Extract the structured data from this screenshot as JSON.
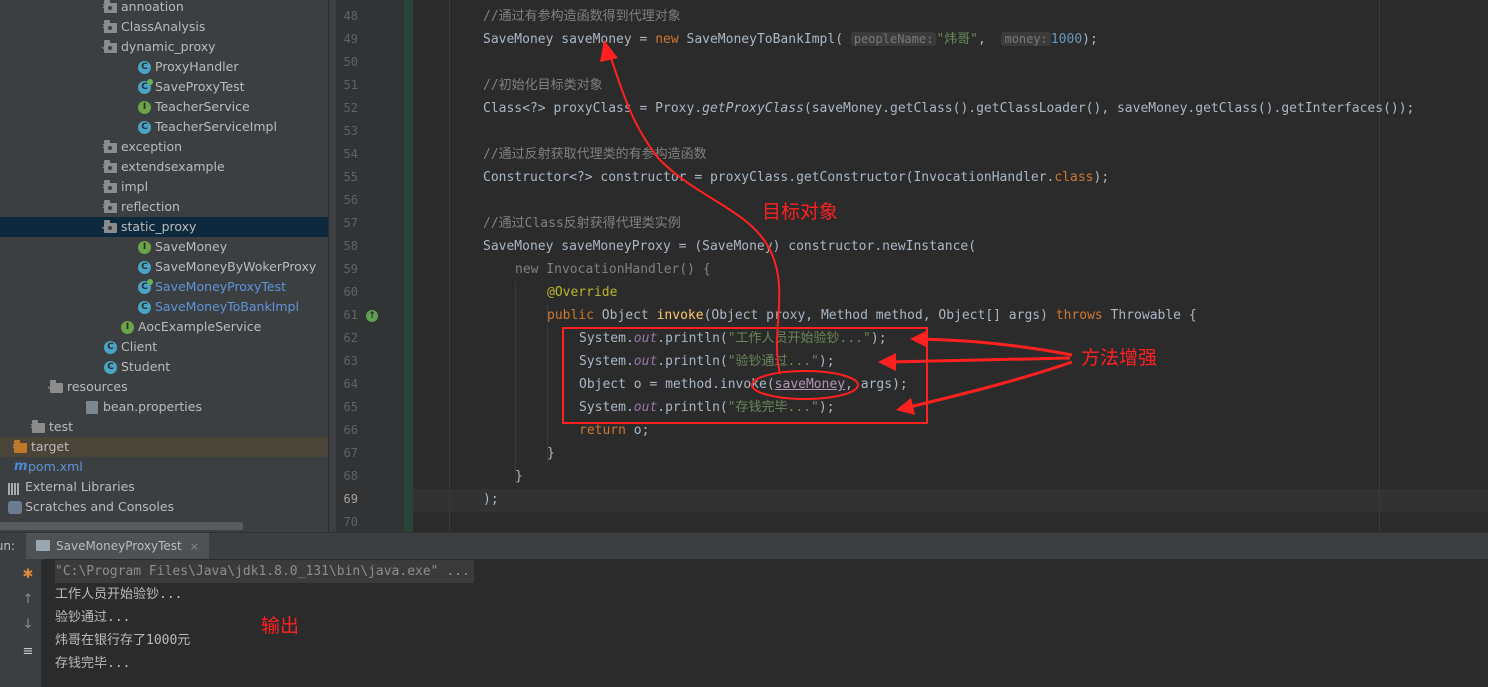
{
  "project_tree": {
    "items": [
      {
        "label": "annoation",
        "type": "package",
        "arrow": "›"
      },
      {
        "label": "ClassAnalysis",
        "type": "package",
        "arrow": "›"
      },
      {
        "label": "dynamic_proxy",
        "type": "package",
        "arrow": "⌄"
      },
      {
        "label": "ProxyHandler",
        "type": "class"
      },
      {
        "label": "SaveProxyTest",
        "type": "test-class"
      },
      {
        "label": "TeacherService",
        "type": "interface"
      },
      {
        "label": "TeacherServiceImpl",
        "type": "class"
      },
      {
        "label": "exception",
        "type": "package",
        "arrow": "›"
      },
      {
        "label": "extendsexample",
        "type": "package",
        "arrow": "›"
      },
      {
        "label": "impl",
        "type": "package",
        "arrow": "›"
      },
      {
        "label": "reflection",
        "type": "package",
        "arrow": "›"
      },
      {
        "label": "static_proxy",
        "type": "package",
        "arrow": "⌄"
      },
      {
        "label": "SaveMoney",
        "type": "interface"
      },
      {
        "label": "SaveMoneyByWokerProxy",
        "type": "class"
      },
      {
        "label": "SaveMoneyProxyTest",
        "type": "test-class"
      },
      {
        "label": "SaveMoneyToBankImpl",
        "type": "class"
      },
      {
        "label": "AocExampleService",
        "type": "interface"
      },
      {
        "label": "Client",
        "type": "class"
      },
      {
        "label": "Student",
        "type": "class"
      },
      {
        "label": "resources",
        "type": "folder",
        "arrow": "⌄"
      },
      {
        "label": "bean.properties",
        "type": "properties"
      },
      {
        "label": "test",
        "type": "folder",
        "arrow": "›"
      },
      {
        "label": "target",
        "type": "folder",
        "arrow": "›"
      },
      {
        "label": "pom.xml",
        "type": "maven"
      },
      {
        "label": "External Libraries",
        "type": "library"
      },
      {
        "label": "Scratches and Consoles",
        "type": "scratch"
      }
    ]
  },
  "editor": {
    "line_numbers": [
      "48",
      "49",
      "50",
      "51",
      "52",
      "53",
      "54",
      "55",
      "56",
      "57",
      "58",
      "59",
      "60",
      "61",
      "62",
      "63",
      "64",
      "65",
      "66",
      "67",
      "68",
      "69",
      "70"
    ],
    "hints": {
      "people_name": "peopleName:",
      "money": "money:"
    },
    "line48": "//通过有参构造函数得到代理对象",
    "line51": "//初始化目标类对象",
    "line54": "//通过反射获取代理类的有参构造函数",
    "line57": "//通过Class反射获得代理类实例",
    "str_name": "\"炜哥\"",
    "num_money": "1000",
    "str_start": "\"工作人员开始验钞...\"",
    "str_pass": "\"验钞通过...\"",
    "str_done": "\"存钱完毕...\""
  },
  "run_panel": {
    "label": "Run:",
    "tab": "SaveMoneyProxyTest",
    "close": "×",
    "output": [
      "\"C:\\Program Files\\Java\\jdk1.8.0_131\\bin\\java.exe\" ...",
      "工作人员开始验钞...",
      "验钞通过...",
      "炜哥在银行存了1000元",
      "存钱完毕..."
    ]
  },
  "annotations": {
    "target_object": "目标对象",
    "method_enhance": "方法增强",
    "output": "输出",
    "color": "#ff2020"
  }
}
